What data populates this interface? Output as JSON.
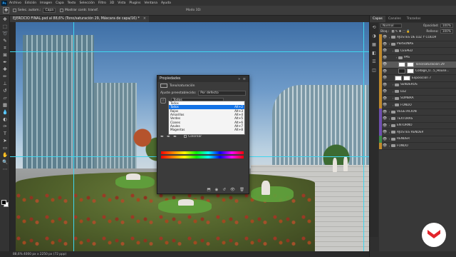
{
  "menubar": {
    "items": [
      "Archivo",
      "Edición",
      "Imagen",
      "Capa",
      "Texto",
      "Selección",
      "Filtro",
      "3D",
      "Vista",
      "Plugins",
      "Ventana",
      "Ayuda"
    ]
  },
  "options": {
    "auto_select_label": "Selec. autom.:",
    "auto_select_value": "Capa",
    "show_transform_label": "Mostrar contr. transf.",
    "mode3d_label": "Modo 3D:"
  },
  "document": {
    "tab_title": "EJERCICIO FINAL.psd al 88,6% (Tono/saturación 29, Máscara de capa/16) *",
    "status": "88,6%   4000 px x 2250 px (72 ppp)"
  },
  "properties": {
    "panel_title": "Propiedades",
    "adjustment_name": "Tono/saturación",
    "preset_label": "Ajuste preestablecido:",
    "preset_value": "Por defecto",
    "channel_value": "Todos",
    "colorize_label": "Colorear",
    "channel_options": [
      {
        "label": "Todos",
        "shortcut": "Alt+2"
      },
      {
        "label": "Rojos",
        "shortcut": "Alt+3"
      },
      {
        "label": "Amarillos",
        "shortcut": "Alt+4"
      },
      {
        "label": "Verdes",
        "shortcut": "Alt+5"
      },
      {
        "label": "Cianes",
        "shortcut": "Alt+6"
      },
      {
        "label": "Azules",
        "shortcut": "Alt+7"
      },
      {
        "label": "Magentas",
        "shortcut": "Alt+8"
      }
    ]
  },
  "panels": {
    "tabs": [
      "Capas",
      "Canales",
      "Trazados"
    ],
    "blend_mode": "Normal",
    "opacity_label": "Opacidad:",
    "opacity_value": "100%",
    "fill_label": "Relleno:",
    "fill_value": "100%",
    "lock_label": "Bloq.:"
  },
  "layers": [
    {
      "name": "AJUSTES DE LUZ Y COLOR",
      "type": "folder",
      "indent": 0,
      "color": "#c08a2c"
    },
    {
      "name": "PERSONAS",
      "type": "folder",
      "indent": 0,
      "color": "#c08a2c"
    },
    {
      "name": "CÉSPED",
      "type": "folder",
      "indent": 1,
      "color": "#c08a2c"
    },
    {
      "name": "PAS",
      "type": "folder",
      "indent": 2,
      "color": "#c08a2c"
    },
    {
      "name": "Tono/saturación 29",
      "type": "adjust",
      "indent": 3,
      "color": "#c08a2c",
      "active": true
    },
    {
      "name": "Collage_0...5_House...",
      "type": "image",
      "indent": 3,
      "color": "#c08a2c"
    },
    {
      "name": "Exposición 7",
      "type": "adjust",
      "indent": 2,
      "color": "#c08a2c"
    },
    {
      "name": "SENDEROS",
      "type": "folder",
      "indent": 1,
      "color": "#c08a2c"
    },
    {
      "name": "LUZ",
      "type": "folder",
      "indent": 1,
      "color": "#c08a2c"
    },
    {
      "name": "SOMBRA",
      "type": "folder",
      "indent": 1,
      "color": "#c08a2c"
    },
    {
      "name": "FONDO",
      "type": "folder",
      "indent": 1,
      "color": "#c08a2c"
    },
    {
      "name": "VEGETACIÓN",
      "type": "folder",
      "indent": 0,
      "color": "#6f4fb0"
    },
    {
      "name": "TEXTURAS",
      "type": "folder",
      "indent": 0,
      "color": "#6f4fb0"
    },
    {
      "name": "ENTORNO",
      "type": "folder",
      "indent": 0,
      "color": "#6f4fb0"
    },
    {
      "name": "AJUSTES RENDER",
      "type": "folder",
      "indent": 0,
      "color": "#6f4fb0"
    },
    {
      "name": "RENDER",
      "type": "folder",
      "indent": 0,
      "color": "#3c8a4a"
    },
    {
      "name": "FONDO",
      "type": "folder",
      "indent": 0,
      "color": "#c08a2c"
    }
  ]
}
